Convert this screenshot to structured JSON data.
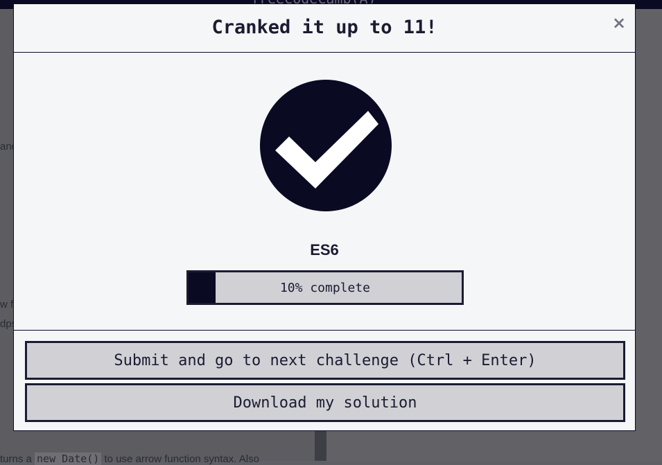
{
  "background": {
    "header_title": "freeCodeCamp(A)",
    "fragments": [
      "and",
      "w fu",
      "dps"
    ],
    "bottom_line": {
      "prefix": "turns a ",
      "code": "new Date()",
      "suffix": " to use arrow function syntax. Also"
    }
  },
  "modal": {
    "title": "Cranked it up to 11!",
    "close_label": "×",
    "icon": "check-circle-icon",
    "certification": "ES6",
    "progress": {
      "percent": 10,
      "label": "10% complete"
    },
    "buttons": {
      "submit": "Submit and go to next challenge (Ctrl + Enter)",
      "download": "Download my solution"
    }
  },
  "colors": {
    "primary": "#0a0a23",
    "modal_bg": "#f5f6f7",
    "button_bg": "#d0d0d5",
    "text": "#1b1b32"
  }
}
